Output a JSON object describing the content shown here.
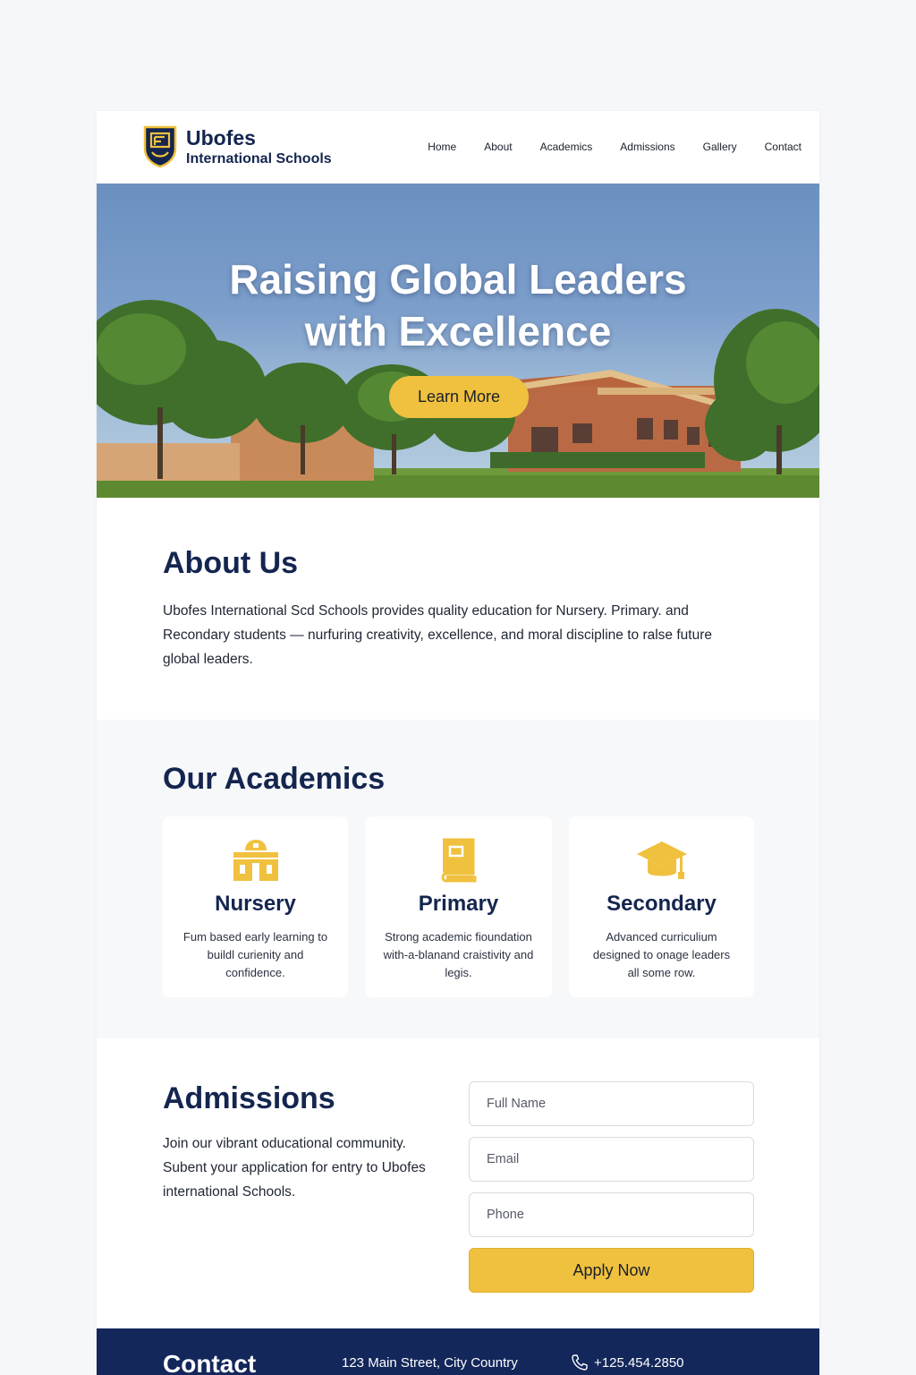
{
  "brand": {
    "name": "Ubofes",
    "subtitle": "International Schools",
    "colors": {
      "navy": "#14254f",
      "gold": "#f0c13e"
    }
  },
  "nav": {
    "items": [
      "Home",
      "About",
      "Academics",
      "Admissions",
      "Gallery",
      "Contact"
    ]
  },
  "hero": {
    "title_line1": "Raising Global Leaders",
    "title_line2": "with Excellence",
    "button_label": "Learn More"
  },
  "about": {
    "title": "About Us",
    "text": "Ubofes International Scd Schools provides quality education for Nursery. Primary. and Recondary students — nurfuring creativity, excellence, and moral discipline to ralse future global leaders."
  },
  "academics": {
    "title": "Our Academics",
    "cards": [
      {
        "title": "Nursery",
        "desc": "Fum based early learning to buildl curienity and confidence.",
        "icon": "school-house-icon"
      },
      {
        "title": "Primary",
        "desc": "Strong academic fioundation with-a-blanand craistivity and legis.",
        "icon": "book-icon"
      },
      {
        "title": "Secondary",
        "desc": "Advanced curriculium designed to onage leaders all some row.",
        "icon": "graduation-cap-icon"
      }
    ]
  },
  "admissions": {
    "title": "Admissions",
    "text": "Join our vibrant oducational community. Subent your application for entry to Ubofes international Schools.",
    "fields": {
      "full_name_placeholder": "Full Name",
      "email_placeholder": "Email",
      "phone_placeholder": "Phone"
    },
    "submit_label": "Apply Now"
  },
  "footer": {
    "title": "Contact",
    "address": "123 Main Street, City Country",
    "phone": "+125.454.2850"
  }
}
